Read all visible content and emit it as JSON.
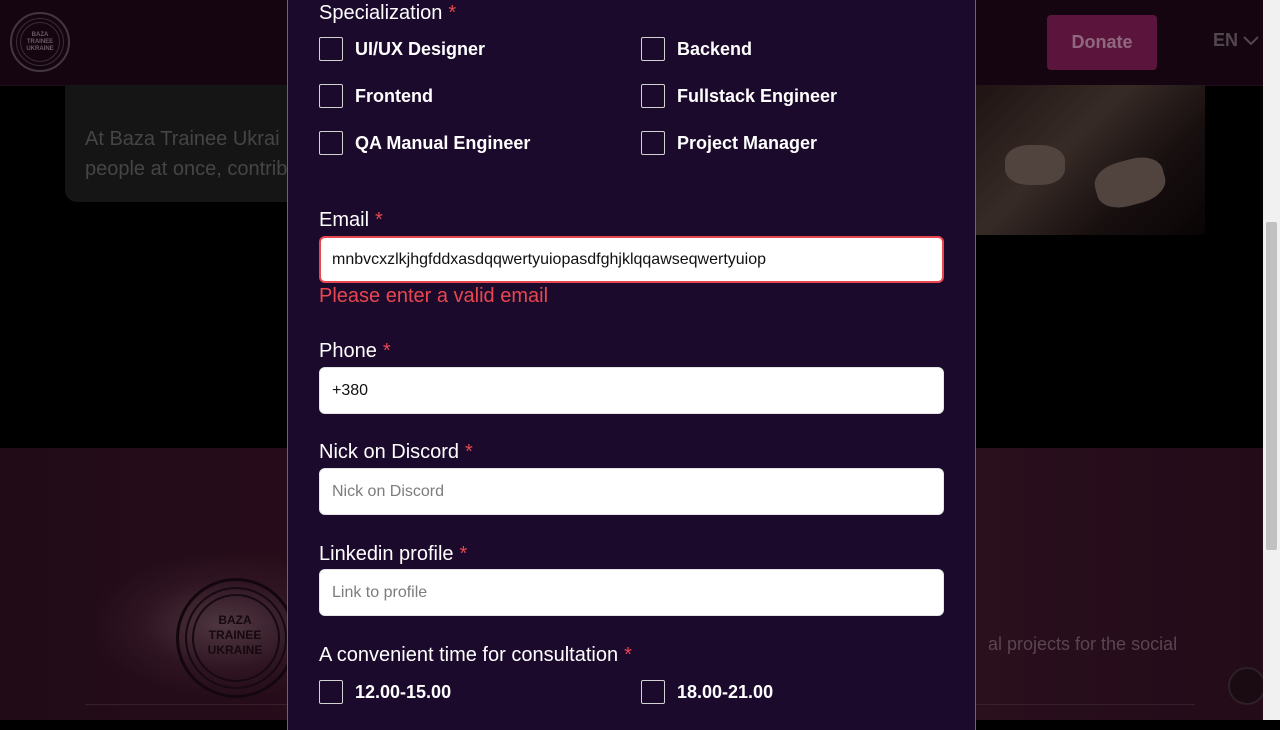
{
  "header": {
    "logo_text": [
      "BAZA",
      "TRAINEE",
      "UKRAINE"
    ],
    "donate_label": "Donate",
    "language": "EN"
  },
  "background": {
    "card_text_line1": "At Baza Trainee Ukrai",
    "card_text_line2": "people at once, contrib",
    "footer_logo_text": [
      "BAZA",
      "TRAINEE",
      "UKRAINE"
    ],
    "footer_text": "al projects for the social"
  },
  "form": {
    "specialization": {
      "label": "Specialization",
      "required_mark": "*",
      "options": [
        {
          "label": "UI/UX Designer",
          "checked": false
        },
        {
          "label": "Backend",
          "checked": false
        },
        {
          "label": "Frontend",
          "checked": false
        },
        {
          "label": "Fullstack Engineer",
          "checked": false
        },
        {
          "label": "QA Manual Engineer",
          "checked": false
        },
        {
          "label": "Project Manager",
          "checked": false
        }
      ]
    },
    "email": {
      "label": "Email",
      "required_mark": "*",
      "value": "mnbvcxzlkjhgfddxasdqqwertyuiopasdfghjklqqawseqwertyuiop",
      "error": "Please enter a valid email"
    },
    "phone": {
      "label": "Phone",
      "required_mark": "*",
      "value": "+380"
    },
    "discord": {
      "label": "Nick on Discord",
      "required_mark": "*",
      "value": "",
      "placeholder": "Nick on Discord"
    },
    "linkedin": {
      "label": "Linkedin profile",
      "required_mark": "*",
      "value": "",
      "placeholder": "Link to profile"
    },
    "consultation_time": {
      "label": "A convenient time for consultation",
      "required_mark": "*",
      "options": [
        {
          "label": "12.00-15.00",
          "checked": false
        },
        {
          "label": "18.00-21.00",
          "checked": false
        }
      ]
    }
  },
  "colors": {
    "modal_bg": "#1c0a2c",
    "modal_border": "#b43c8e",
    "error": "#e8474f",
    "donate": "#7a1d52"
  },
  "icons": {
    "language_dropdown": "chevron-down-icon",
    "scroll_top": "arrow-up-icon"
  }
}
